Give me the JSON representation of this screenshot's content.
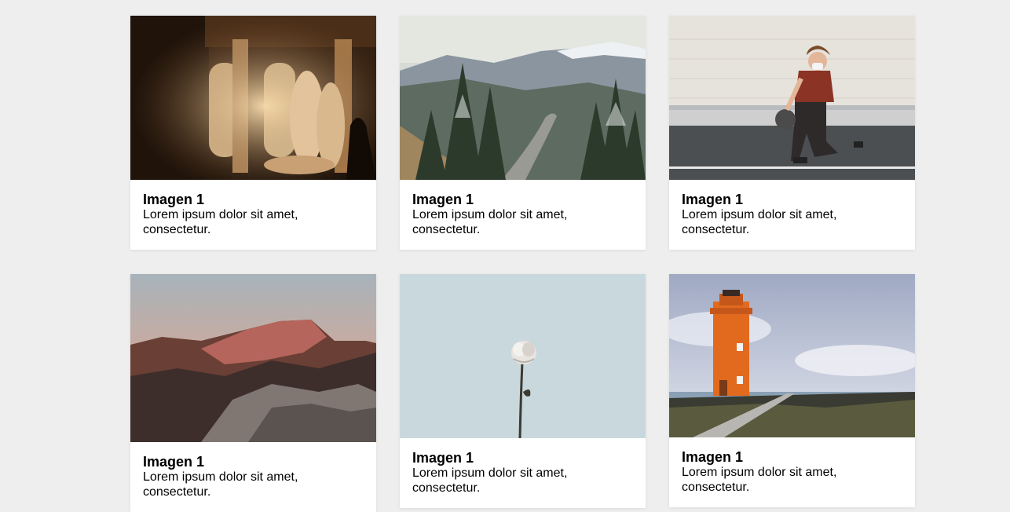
{
  "gallery": {
    "cards": [
      {
        "title": "Imagen 1",
        "text": "Lorem ipsum dolor sit amet, consectetur.",
        "image_subject": "museum-statues-hall"
      },
      {
        "title": "Imagen 1",
        "text": "Lorem ipsum dolor sit amet, consectetur.",
        "image_subject": "mountain-road-pine-forest"
      },
      {
        "title": "Imagen 1",
        "text": "Lorem ipsum dolor sit amet, consectetur.",
        "image_subject": "man-dribbling-basketball"
      },
      {
        "title": "Imagen 1",
        "text": "Lorem ipsum dolor sit amet, consectetur.",
        "image_subject": "rocky-mountain-sunset"
      },
      {
        "title": "Imagen 1",
        "text": "Lorem ipsum dolor sit amet, consectetur.",
        "image_subject": "white-rose-sky"
      },
      {
        "title": "Imagen 1",
        "text": "Lorem ipsum dolor sit amet, consectetur.",
        "image_subject": "orange-lighthouse-coast"
      }
    ]
  }
}
